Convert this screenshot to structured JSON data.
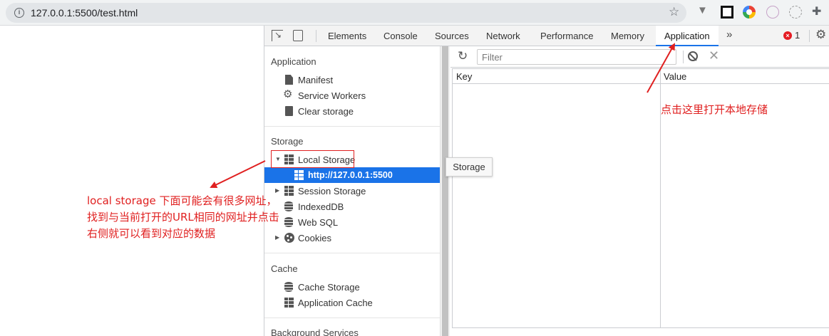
{
  "browser": {
    "url": "127.0.0.1:5500/test.html",
    "icons": [
      "info-icon",
      "star-icon",
      "vue-devtools-icon",
      "black-square-extension-icon",
      "chrome-color-extension-icon",
      "react-icon",
      "spinner-extension-icon",
      "puzzle-extensions-icon"
    ]
  },
  "devtools": {
    "tabs": [
      {
        "label": "Elements"
      },
      {
        "label": "Console"
      },
      {
        "label": "Sources"
      },
      {
        "label": "Network"
      },
      {
        "label": "Performance"
      },
      {
        "label": "Memory"
      },
      {
        "label": "Application",
        "active": true
      }
    ],
    "more_tabs": "»",
    "error_count": "1",
    "accent_color": "#1a73e8",
    "error_color": "#e51c23"
  },
  "sidebar": {
    "application": {
      "title": "Application",
      "items": [
        {
          "label": "Manifest",
          "icon": "file-icon"
        },
        {
          "label": "Service Workers",
          "icon": "gear-icon"
        },
        {
          "label": "Clear storage",
          "icon": "trash-icon"
        }
      ]
    },
    "storage": {
      "title": "Storage",
      "local_storage": "Local Storage",
      "local_storage_origin": "http://127.0.0.1:5500",
      "session_storage": "Session Storage",
      "indexeddb": "IndexedDB",
      "web_sql": "Web SQL",
      "cookies": "Cookies"
    },
    "cache": {
      "title": "Cache",
      "items": [
        {
          "label": "Cache Storage",
          "icon": "database-icon"
        },
        {
          "label": "Application Cache",
          "icon": "grid-icon"
        }
      ]
    },
    "background_services": {
      "title": "Background Services"
    }
  },
  "main": {
    "filter_placeholder": "Filter",
    "columns": {
      "key": "Key",
      "value": "Value"
    },
    "rows": []
  },
  "tooltip": "Storage",
  "annotations": {
    "note_right": "点击这里打开本地存储",
    "note_left_lines": [
      "local storage 下面可能会有很多网址，",
      "找到与当前打开的URL相同的网址并点击",
      "右侧就可以看到对应的数据"
    ],
    "color": "#e02020"
  }
}
